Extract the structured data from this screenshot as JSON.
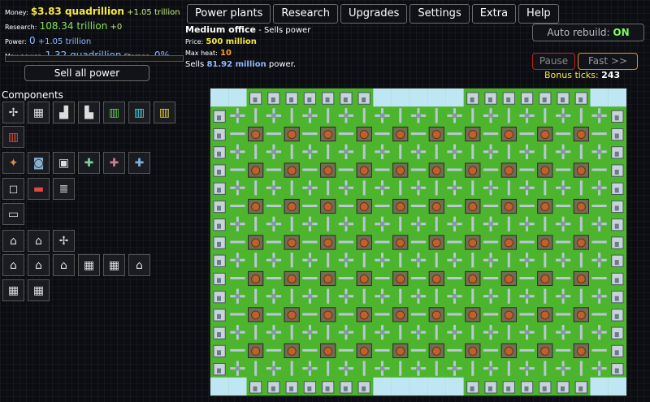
{
  "stats": {
    "money_label": "Money:",
    "money_value": "$3.83 quadrillion",
    "money_rate": "+1.05 trillion",
    "research_label": "Research:",
    "research_value": "108.34 trillion",
    "research_rate": "+0",
    "power_label": "Power:",
    "power_value": "0",
    "power_rate": "+1.05 trillion",
    "maxpower_label": "Max power:",
    "maxpower_value": "1.32 quadrillion",
    "storage_label": "Storage:",
    "storage_value": "0%"
  },
  "sell_all_label": "Sell all power",
  "tabs": [
    "Power plants",
    "Research",
    "Upgrades",
    "Settings",
    "Extra",
    "Help"
  ],
  "info": {
    "name": "Medium office",
    "desc": "- Sells power",
    "price_label": "Price:",
    "price_value": "500 million",
    "heat_label": "Max heat:",
    "heat_value": "10",
    "sells_prefix": "Sells",
    "sells_value": "81.92 million",
    "sells_suffix": "power."
  },
  "controls": {
    "auto_rebuild_label": "Auto rebuild:",
    "auto_rebuild_state": "ON",
    "pause_label": "Pause",
    "fast_label": "Fast >>",
    "bonus_label": "Bonus ticks:",
    "bonus_value": "243"
  },
  "components_heading": "Components",
  "components": [
    [
      "wind-turbine-icon",
      "solar-panel-icon",
      "coal-plant-icon",
      "factory-icon",
      "green-cell-icon",
      "cyan-cell-icon",
      "yellow-cell-icon"
    ],
    [
      "red-cell-icon"
    ],
    [
      "heat-exchanger-icon",
      "cooling-fan-icon",
      "vent-icon",
      "pipe-cross-green-icon",
      "pipe-cross-red-icon",
      "pipe-cross-blue-icon"
    ],
    [
      "isolation-plate-icon",
      "battery-icon",
      "resistor-icon"
    ],
    [
      "storage-block-icon"
    ],
    [
      "house-icon",
      "office-icon",
      "wind-farm-icon"
    ],
    [
      "shop-icon",
      "small-house-icon",
      "big-house-icon",
      "apartment-icon",
      "office-tower-icon",
      "bank-icon"
    ],
    [
      "mall-icon",
      "hospital-icon"
    ]
  ]
}
